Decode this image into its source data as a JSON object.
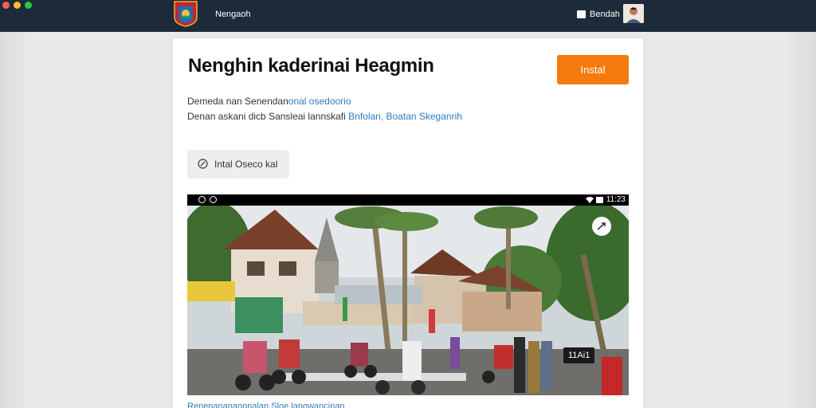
{
  "window": {
    "app_title": "Nengaoh",
    "account_label": "Bendah"
  },
  "article": {
    "title": "Nenghin kaderinai Heagmin",
    "install_label": "Instal",
    "description_line1_text": "Demeda nan Senendan",
    "description_line1_link": "onal osedoorio",
    "description_line2_text": "Denan askani dicb Sansleai lannskafi",
    "description_line2_link": "Bnfolan, Boatan Skeganrih",
    "chip_label": "Intal Oseco kal"
  },
  "media": {
    "status_time": "11:23",
    "overlay_caption": "11Ai1"
  },
  "footer": {
    "link_text": "Renenanananonalan Sloe lanowancinan"
  },
  "colors": {
    "topbar": "#1d2a3a",
    "accent": "#f47b0e",
    "link": "#2f7bbd"
  },
  "icons": {
    "logo": "regional-crest",
    "chip": "tag-icon",
    "share": "share-icon"
  }
}
